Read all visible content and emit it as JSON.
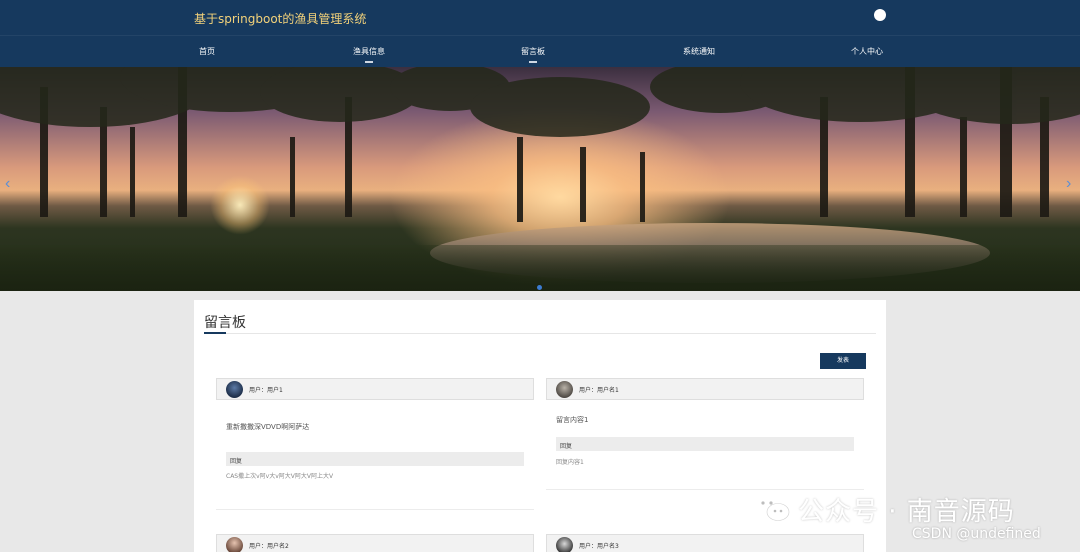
{
  "header": {
    "site_title": "基于springboot的渔具管理系统",
    "nav": [
      {
        "label": "首页",
        "active": false
      },
      {
        "label": "渔具信息",
        "active": false
      },
      {
        "label": "留言板",
        "active": true
      },
      {
        "label": "系统通知",
        "active": false
      },
      {
        "label": "个人中心",
        "active": false
      }
    ]
  },
  "banner": {
    "prev_arrow": "‹",
    "next_arrow": "›"
  },
  "board": {
    "title": "留言板",
    "post_button": "发表",
    "messages": [
      {
        "user": "用户：用户1",
        "content": "重新撒撒深VDVD啊阿萨达",
        "reply_label": "回复",
        "reply": "CAS撒上次v阿v大v阿大V阿大V阿上大V"
      },
      {
        "user": "用户：用户名1",
        "content": "留言内容1",
        "reply_label": "回复",
        "reply": "回复内容1"
      },
      {
        "user": "用户：用户名2"
      },
      {
        "user": "用户：用户名3"
      }
    ]
  },
  "watermark": {
    "text": "公众号 · 南音源码",
    "credit": "CSDN @undefined"
  },
  "colors": {
    "header_bg": "#16395e",
    "title_gold": "#f3d27a",
    "button_bg": "#16395e"
  }
}
